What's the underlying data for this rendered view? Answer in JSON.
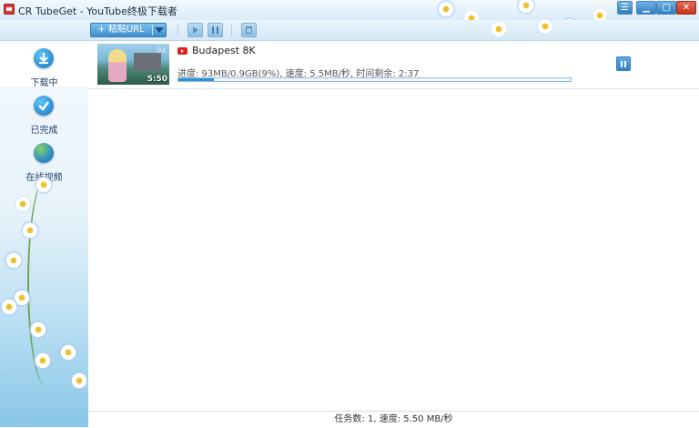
{
  "window": {
    "title": "CR TubeGet - YouTube终极下载者",
    "buttons": [
      "menu",
      "minimize",
      "maximize",
      "close"
    ]
  },
  "toolbar": {
    "paste_label": "+ 粘贴URL",
    "buttons": [
      "start",
      "pause",
      "delete"
    ]
  },
  "sidebar": {
    "items": [
      {
        "label": "下载中",
        "icon": "download-icon",
        "active": true
      },
      {
        "label": "已完成",
        "icon": "check-icon",
        "active": false
      },
      {
        "label": "在线视频",
        "icon": "globe-icon",
        "active": false
      }
    ]
  },
  "downloads": [
    {
      "title": "Budapest 8K",
      "duration": "5:50",
      "thumb_badge": "8K",
      "source_icon": "youtube-icon",
      "progress_text": "进度: 93MB/0.9GB(9%), 速度: 5.5MB/秒, 时间剩余: 2:37",
      "progress_fraction": 0.09
    }
  ],
  "status": {
    "text": "任务数: 1, 速度: 5.50 MB/秒"
  },
  "colors": {
    "accent": "#2e91d8",
    "youtube_red": "#e0201a"
  }
}
